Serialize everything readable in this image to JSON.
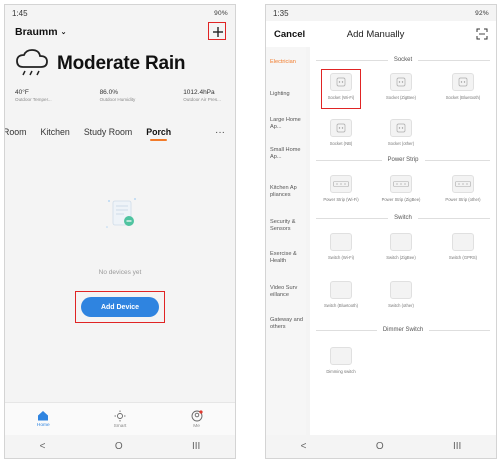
{
  "left_phone": {
    "status": {
      "time": "1:45",
      "right": "90%"
    },
    "home_name": "Braumm",
    "weather": {
      "condition": "Moderate Rain",
      "stats": [
        {
          "value": "40°F",
          "label": "Outdoor Temper..."
        },
        {
          "value": "86.0%",
          "label": "Outdoor Humidity"
        },
        {
          "value": "1012.4hPa",
          "label": "Outdoor Air Pres..."
        }
      ]
    },
    "rooms": [
      "Room",
      "Kitchen",
      "Study Room",
      "Porch"
    ],
    "active_room": "Porch",
    "more": "···",
    "empty_text": "No devices yet",
    "add_device_label": "Add Device",
    "tabs": [
      "Home",
      "Smart",
      "Me"
    ],
    "nav": [
      "<",
      "O",
      "III"
    ],
    "accent": "#2f84e0",
    "highlight": "#e02424"
  },
  "right_phone": {
    "status": {
      "time": "1:35",
      "right": "92%"
    },
    "cancel_label": "Cancel",
    "title": "Add Manually",
    "categories": [
      "Electrician",
      "Lighting",
      "Large Home Ap...",
      "Small Home Ap...",
      "Kitchen Ap pliances",
      "Security & Sensors",
      "Exercise & Health",
      "Video Surv eillance",
      "Gateway and others"
    ],
    "sections": {
      "socket": {
        "title": "Socket",
        "items": [
          "Socket (Wi-Fi)",
          "Socket (ZigBee)",
          "Socket (Bluetooth)",
          "Socket (NB)",
          "Socket (other)"
        ]
      },
      "power_strip": {
        "title": "Power Strip",
        "items": [
          "Power Strip (Wi-Fi)",
          "Power Strip (ZigBee)",
          "Power Strip (other)"
        ]
      },
      "switch": {
        "title": "Switch",
        "items": [
          "Switch (Wi-Fi)",
          "Switch (ZigBee)",
          "Switch (GPRS)",
          "Switch (Bluetooth)",
          "Switch (other)"
        ]
      },
      "dimmer": {
        "title": "Dimmer Switch",
        "items": [
          "Dimming switch"
        ]
      }
    },
    "nav": [
      "<",
      "O",
      "III"
    ]
  }
}
